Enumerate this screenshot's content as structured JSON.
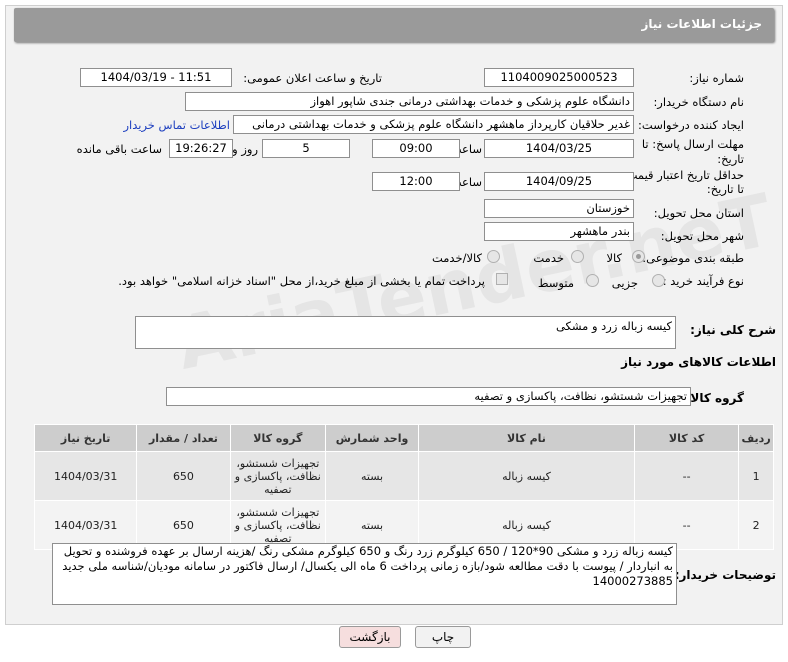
{
  "header": {
    "title": "جزئیات اطلاعات نیاز"
  },
  "fields": {
    "need_number_label": "شماره نیاز:",
    "need_number": "1104009025000523",
    "announce_label": "تاریخ و ساعت اعلان عمومی:",
    "announce_value": "1404/03/19 - 11:51",
    "buyer_org_label": "نام دستگاه خریدار:",
    "buyer_org": "دانشگاه علوم پزشکی و خدمات بهداشتی درمانی جندی شاپور اهواز",
    "requester_label": "ایجاد کننده درخواست:",
    "requester": "غدیر حلاقیان کارپرداز ماهشهر دانشگاه علوم پزشکی و خدمات بهداشتی درمانی",
    "contact_link": "اطلاعات تماس خریدار",
    "deadline_label_1": "مهلت ارسال پاسخ: تا",
    "deadline_label_2": "تاریخ:",
    "deadline_date": "1404/03/25",
    "time_label": "ساعت",
    "deadline_time": "09:00",
    "days_value": "5",
    "days_label": "روز و",
    "remaining_time": "19:26:27",
    "remaining_label": "ساعت باقی مانده",
    "validity_label_1": "حداقل تاریخ اعتبار قیمت:",
    "validity_label_2": "تا تاریخ:",
    "validity_date": "1404/09/25",
    "validity_time": "12:00",
    "province_label": "استان محل تحویل:",
    "province": "خوزستان",
    "city_label": "شهر محل تحویل:",
    "city": "بندر ماهشهر",
    "category_label": "طبقه بندی موضوعی:",
    "cat_goods": "کالا",
    "cat_service": "خدمت",
    "cat_both": "کالا/خدمت",
    "process_label": "نوع فرآیند خرید :",
    "proc_partial": "جزیی",
    "proc_medium": "متوسط",
    "payment_note": "پرداخت تمام یا بخشی از مبلغ خرید،از محل \"اسناد خزانه اسلامی\" خواهد بود."
  },
  "summary": {
    "label": "شرح کلی نیاز:",
    "value": "کیسه زباله زرد و مشکی"
  },
  "goods_section_title": "اطلاعات کالاهای مورد نیاز",
  "goods_group": {
    "label": "گروه کالا:",
    "value": "تجهیزات شستشو، نظافت، پاکسازی و تصفیه"
  },
  "table": {
    "headers": [
      "ردیف",
      "کد کالا",
      "نام کالا",
      "واحد شمارش",
      "گروه کالا",
      "تعداد / مقدار",
      "تاریخ نیاز"
    ],
    "rows": [
      {
        "idx": "1",
        "code": "--",
        "name": "کیسه زباله",
        "unit": "بسته",
        "group": "تجهیزات شستشو، نظافت، پاکسازی و تصفیه",
        "qty": "650",
        "date": "1404/03/31"
      },
      {
        "idx": "2",
        "code": "--",
        "name": "کیسه زباله",
        "unit": "بسته",
        "group": "تجهیزات شستشو، نظافت، پاکسازی و تصفیه",
        "qty": "650",
        "date": "1404/03/31"
      }
    ]
  },
  "buyer_notes": {
    "label": "توضیحات خریدار:",
    "value": "کیسه زباله زرد و مشکی 90*120 / 650 کیلوگرم زرد رنگ و 650 کیلوگرم مشکی رنگ /هزینه ارسال بر عهده فروشنده و تحویل به انباردار / پیوست با دقت مطالعه شود/بازه زمانی پرداخت 6 ماه الی یکسال/ ارسال فاکتور در سامانه مودیان/شناسه ملی جدید 14000273885"
  },
  "buttons": {
    "print": "چاپ",
    "back": "بازگشت"
  },
  "watermark": "AriaTender.neT",
  "colors": {
    "header_bg": "#9a9a9a",
    "link": "#1d3fbf",
    "back_btn_bg": "#f6dede"
  }
}
